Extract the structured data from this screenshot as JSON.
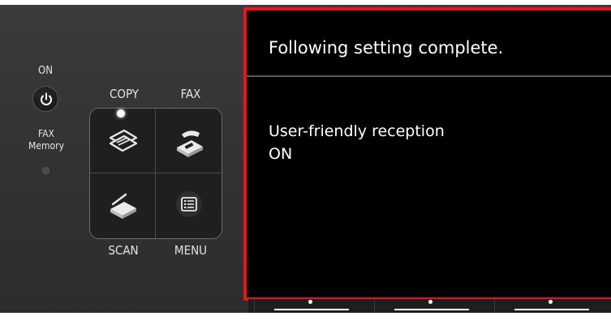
{
  "panel": {
    "power_label": "ON",
    "fax_memory_label_line1": "FAX",
    "fax_memory_label_line2": "Memory",
    "buttons": {
      "copy": "COPY",
      "fax": "FAX",
      "scan": "SCAN",
      "menu": "MENU"
    },
    "icons": [
      "power-icon",
      "copy-icon",
      "fax-icon",
      "scan-icon",
      "menu-icon"
    ]
  },
  "screen": {
    "title": "Following setting complete.",
    "setting_name": "User-friendly reception",
    "setting_value": "ON",
    "highlight_color": "#e8141e"
  },
  "softkeys": [
    "left-softkey",
    "center-softkey",
    "right-softkey"
  ]
}
